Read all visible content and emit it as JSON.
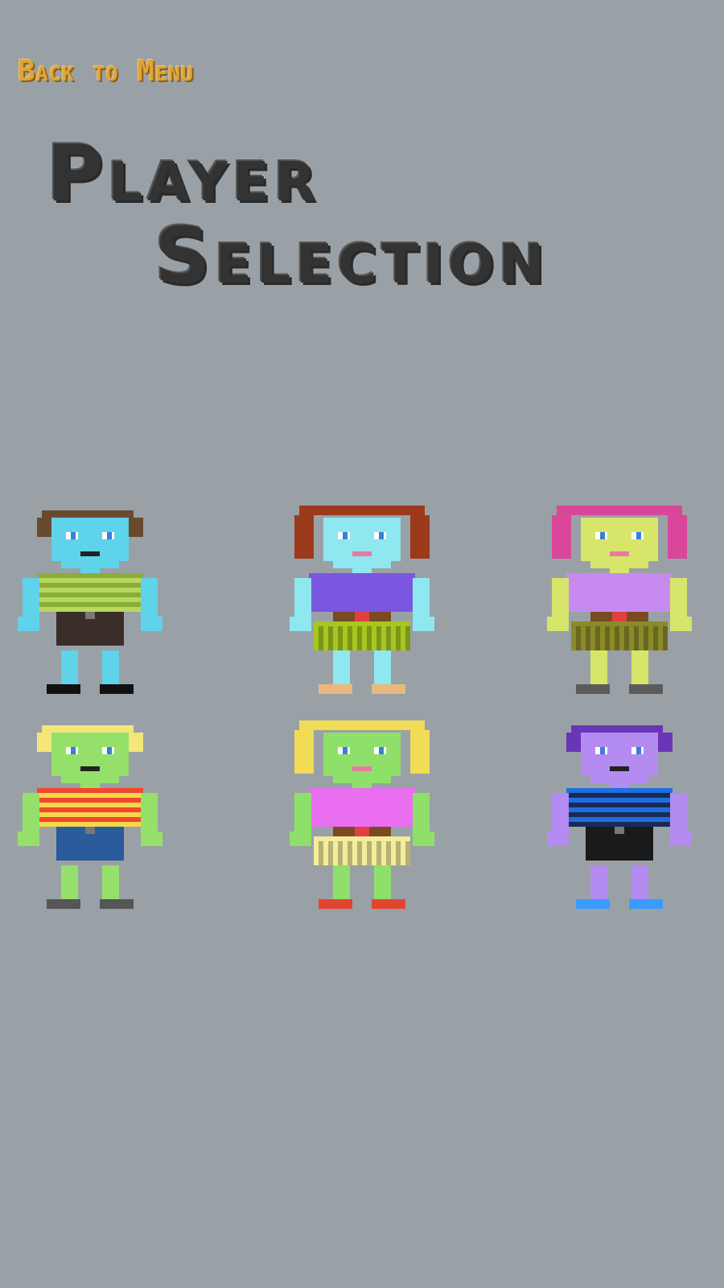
{
  "back_label": "Back to Menu",
  "title": {
    "line1": "Player",
    "line2": "Selection"
  },
  "characters": [
    {
      "skin": "#5fd3ea",
      "hair": "#6a4a2f",
      "shirt": "#8aae3a",
      "stripe": "#b7d85c",
      "bottom": "#3a2f28",
      "shoe": "#111111",
      "style": "boy"
    },
    {
      "skin": "#8fe7ef",
      "hair": "#9c3a1c",
      "shirt": "#7b56e0",
      "stripe": "#7b56e0",
      "bottom": "#a6c71f",
      "shoe": "#e7b97c",
      "style": "girl"
    },
    {
      "skin": "#d7e56a",
      "hair": "#d9469a",
      "shirt": "#c78bf0",
      "stripe": "#c78bf0",
      "bottom": "#8b8a2a",
      "shoe": "#5b5b5b",
      "style": "girl"
    },
    {
      "skin": "#95e06b",
      "hair": "#f4e67a",
      "shirt": "#f2462e",
      "stripe": "#f4d84a",
      "bottom": "#2a5b9a",
      "shoe": "#555555",
      "style": "boy"
    },
    {
      "skin": "#8fe06a",
      "hair": "#f1dd55",
      "shirt": "#ea6ef0",
      "stripe": "#ea6ef0",
      "bottom": "#f3ec9a",
      "shoe": "#e2452f",
      "style": "girl"
    },
    {
      "skin": "#b48bf0",
      "hair": "#6a36b8",
      "shirt": "#1f6ee0",
      "stripe": "#1a2a55",
      "bottom": "#1a1a1a",
      "shoe": "#3b9bff",
      "style": "boy"
    }
  ]
}
